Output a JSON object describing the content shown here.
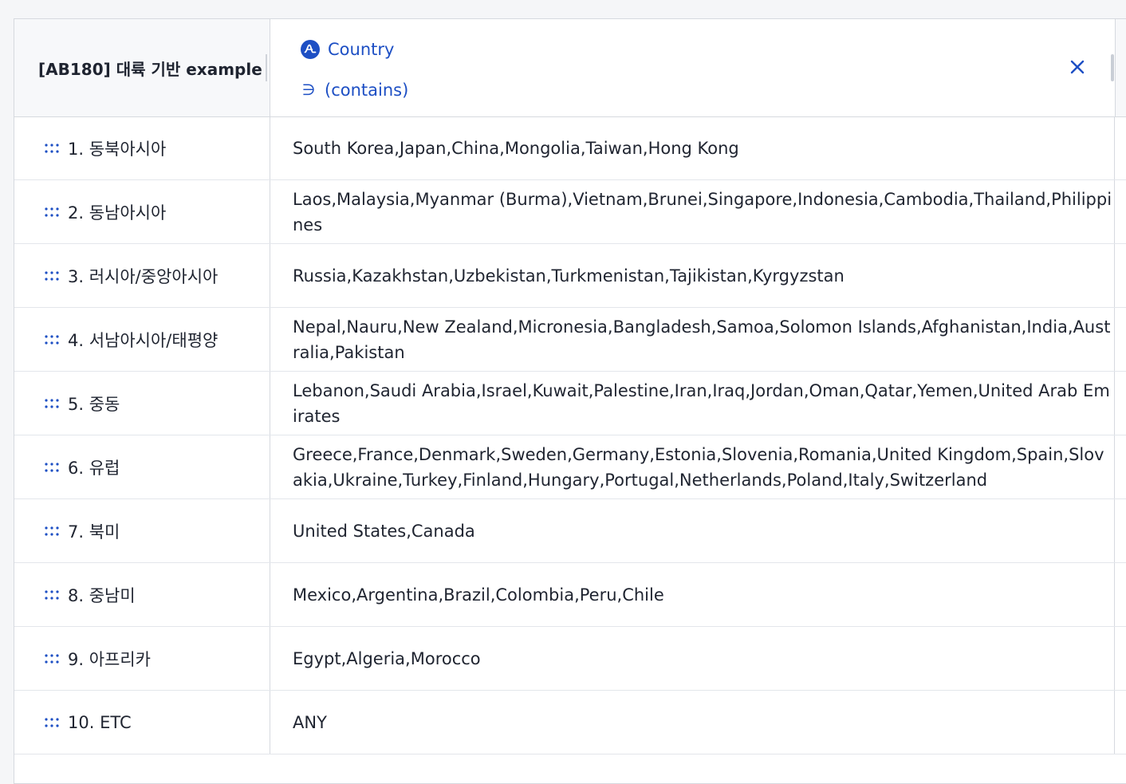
{
  "header": {
    "title": "[AB180] 대륙 기반 example",
    "property_label": "Country",
    "property_icon": "amplitude-icon",
    "operator_label": "(contains)",
    "operator_icon": "contains-icon",
    "close_icon": "close-icon"
  },
  "accent_color": "#1d4fc4",
  "rows": [
    {
      "label": "1. 동북아시아",
      "value": "South Korea,Japan,China,Mongolia,Taiwan,Hong Kong"
    },
    {
      "label": "2. 동남아시아",
      "value": "Laos,Malaysia,Myanmar (Burma),Vietnam,Brunei,Singapore,Indonesia,Cambodia,Thailand,Philippines"
    },
    {
      "label": "3. 러시아/중앙아시아",
      "value": "Russia,Kazakhstan,Uzbekistan,Turkmenistan,Tajikistan,Kyrgyzstan"
    },
    {
      "label": "4. 서남아시아/태평양",
      "value": "Nepal,Nauru,New Zealand,Micronesia,Bangladesh,Samoa,Solomon Islands,Afghanistan,India,Australia,Pakistan"
    },
    {
      "label": "5. 중동",
      "value": "Lebanon,Saudi Arabia,Israel,Kuwait,Palestine,Iran,Iraq,Jordan,Oman,Qatar,Yemen,United Arab Emirates"
    },
    {
      "label": "6. 유럽",
      "value": "Greece,France,Denmark,Sweden,Germany,Estonia,Slovenia,Romania,United Kingdom,Spain,Slovakia,Ukraine,Turkey,Finland,Hungary,Portugal,Netherlands,Poland,Italy,Switzerland"
    },
    {
      "label": "7. 북미",
      "value": "United States,Canada"
    },
    {
      "label": "8. 중남미",
      "value": "Mexico,Argentina,Brazil,Colombia,Peru,Chile"
    },
    {
      "label": "9. 아프리카",
      "value": "Egypt,Algeria,Morocco"
    },
    {
      "label": "10. ETC",
      "value": "ANY"
    }
  ]
}
